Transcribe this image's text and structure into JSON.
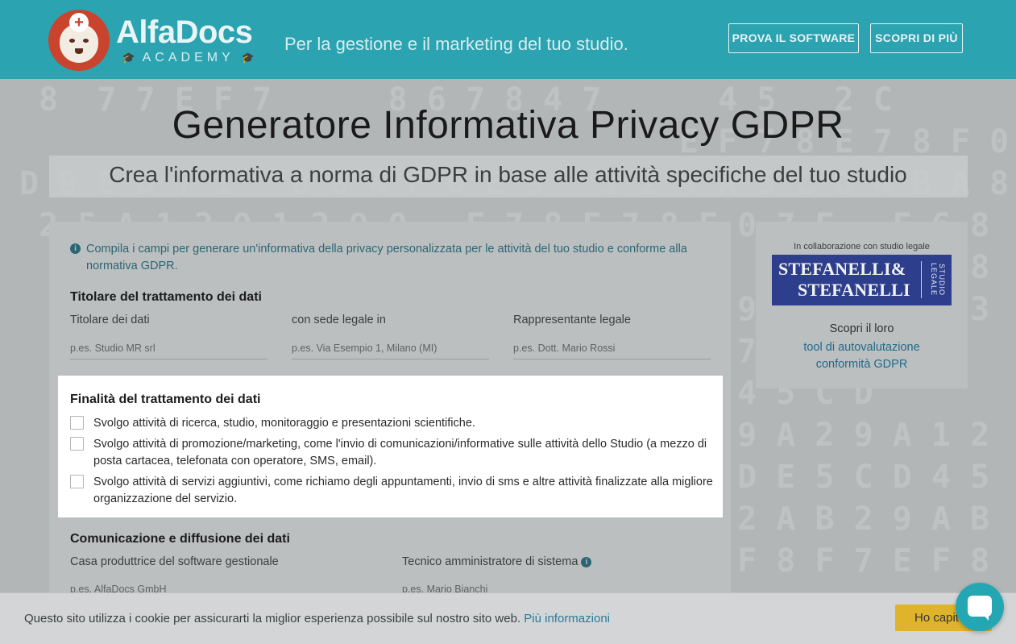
{
  "header": {
    "logo_name": "AlfaDocs",
    "logo_sub": "ACADEMY",
    "tagline": "Per la gestione e il marketing del tuo studio.",
    "btn_try": "PROVA IL SOFTWARE",
    "btn_discover": "SCOPRI DI PIÙ"
  },
  "hero": {
    "title": "Generatore Informativa Privacy GDPR",
    "subtitle": "Crea l'informativa a norma di GDPR in base alle attività specifiche del tuo studio"
  },
  "form": {
    "info": "Compila i campi per generare un'informativa della privacy personalizzata per le attività del tuo studio e conforme alla normativa GDPR.",
    "section_owner": "Titolare del trattamento dei dati",
    "owner_fields": [
      {
        "label": "Titolare dei dati",
        "placeholder": "p.es. Studio MR srl"
      },
      {
        "label": "con sede legale in",
        "placeholder": "p.es. Via Esempio 1, Milano (MI)"
      },
      {
        "label": "Rappresentante legale",
        "placeholder": "p.es. Dott. Mario Rossi"
      }
    ],
    "section_purpose": "Finalità del trattamento dei dati",
    "purposes": [
      "Svolgo attività di ricerca, studio, monitoraggio e presentazioni scientifiche.",
      "Svolgo attività di promozione/marketing, come l'invio di comunicazioni/informative sulle attività dello Studio (a mezzo di posta cartacea, telefonata con operatore, SMS, email).",
      "Svolgo attività di servizi aggiuntivi, come richiamo degli appuntamenti, invio di sms e altre attività finalizzate alla migliore organizzazione del servizio."
    ],
    "section_comm": "Comunicazione e diffusione dei dati",
    "comm_fields": [
      {
        "label": "Casa produttrice del software gestionale",
        "placeholder": "p.es. AlfaDocs GmbH"
      },
      {
        "label": "Tecnico amministratore di sistema",
        "placeholder": "p.es. Mario Bianchi"
      }
    ]
  },
  "sidebar": {
    "caption": "In collaborazione con studio legale",
    "partner_line1": "STEFANELLI&",
    "partner_line2": "STEFANELLI",
    "partner_vertical": "STUDIO LEGALE",
    "text": "Scopri il loro",
    "link": "tool di autovalutazione conformità GDPR"
  },
  "cookie": {
    "text": "Questo sito utilizza i cookie per assicurarti la miglior esperienza possibile sul nostro sito web.",
    "link": "Più informazioni",
    "button": "Ho capito"
  },
  "colors": {
    "header_bg": "#2ba3b0",
    "highlight_bg": "#ffffff",
    "accent_link": "#2a6673",
    "cookie_button": "#e0b42a",
    "partner_logo": "#2d3e8c"
  }
}
